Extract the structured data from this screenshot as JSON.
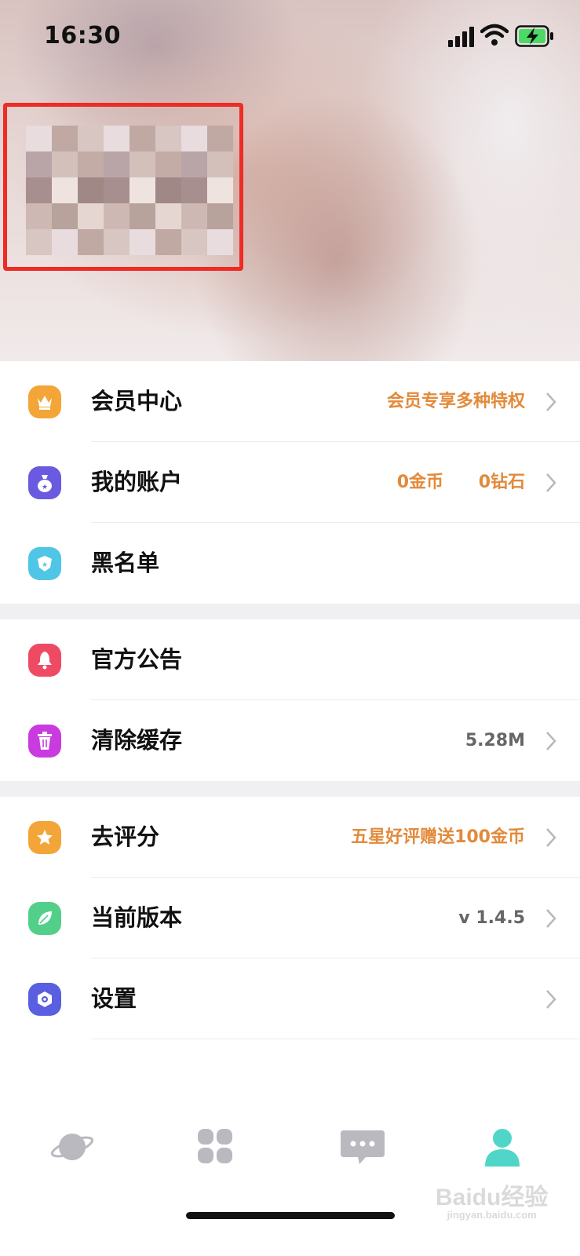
{
  "status_bar": {
    "time": "16:30"
  },
  "menu": {
    "sections": [
      [
        {
          "label": "会员中心",
          "extra": "会员专享多种特权",
          "icon": "crown-icon",
          "color": "#f3a538"
        },
        {
          "label": "我的账户",
          "extra": "0金币",
          "extra2": "0钻石",
          "icon": "money-bag-icon",
          "color": "#6a5ae0"
        },
        {
          "label": "黑名单",
          "icon": "shield-icon",
          "color": "#4fc6e6"
        }
      ],
      [
        {
          "label": "官方公告",
          "icon": "bell-icon",
          "color": "#ee4a63"
        },
        {
          "label": "清除缓存",
          "extra": "5.28M",
          "icon": "trash-icon",
          "color": "#c93be0"
        }
      ],
      [
        {
          "label": "去评分",
          "extra": "五星好评赠送100金币",
          "icon": "star-icon",
          "color": "#f3a538"
        },
        {
          "label": "当前版本",
          "extra": "v 1.4.5",
          "icon": "leaf-icon",
          "color": "#52d08a"
        },
        {
          "label": "设置",
          "icon": "settings-icon",
          "color": "#5a5ee0"
        }
      ]
    ]
  },
  "tabbar": {
    "tabs": [
      {
        "icon": "planet-icon"
      },
      {
        "icon": "apps-grid-icon"
      },
      {
        "icon": "chat-bubble-icon"
      },
      {
        "icon": "person-icon",
        "active": true
      }
    ],
    "active_color": "#4fd6c8",
    "inactive_color": "#b9b9bf"
  },
  "watermark": {
    "brand": "Baidu经验",
    "url": "jingyan.baidu.com"
  }
}
